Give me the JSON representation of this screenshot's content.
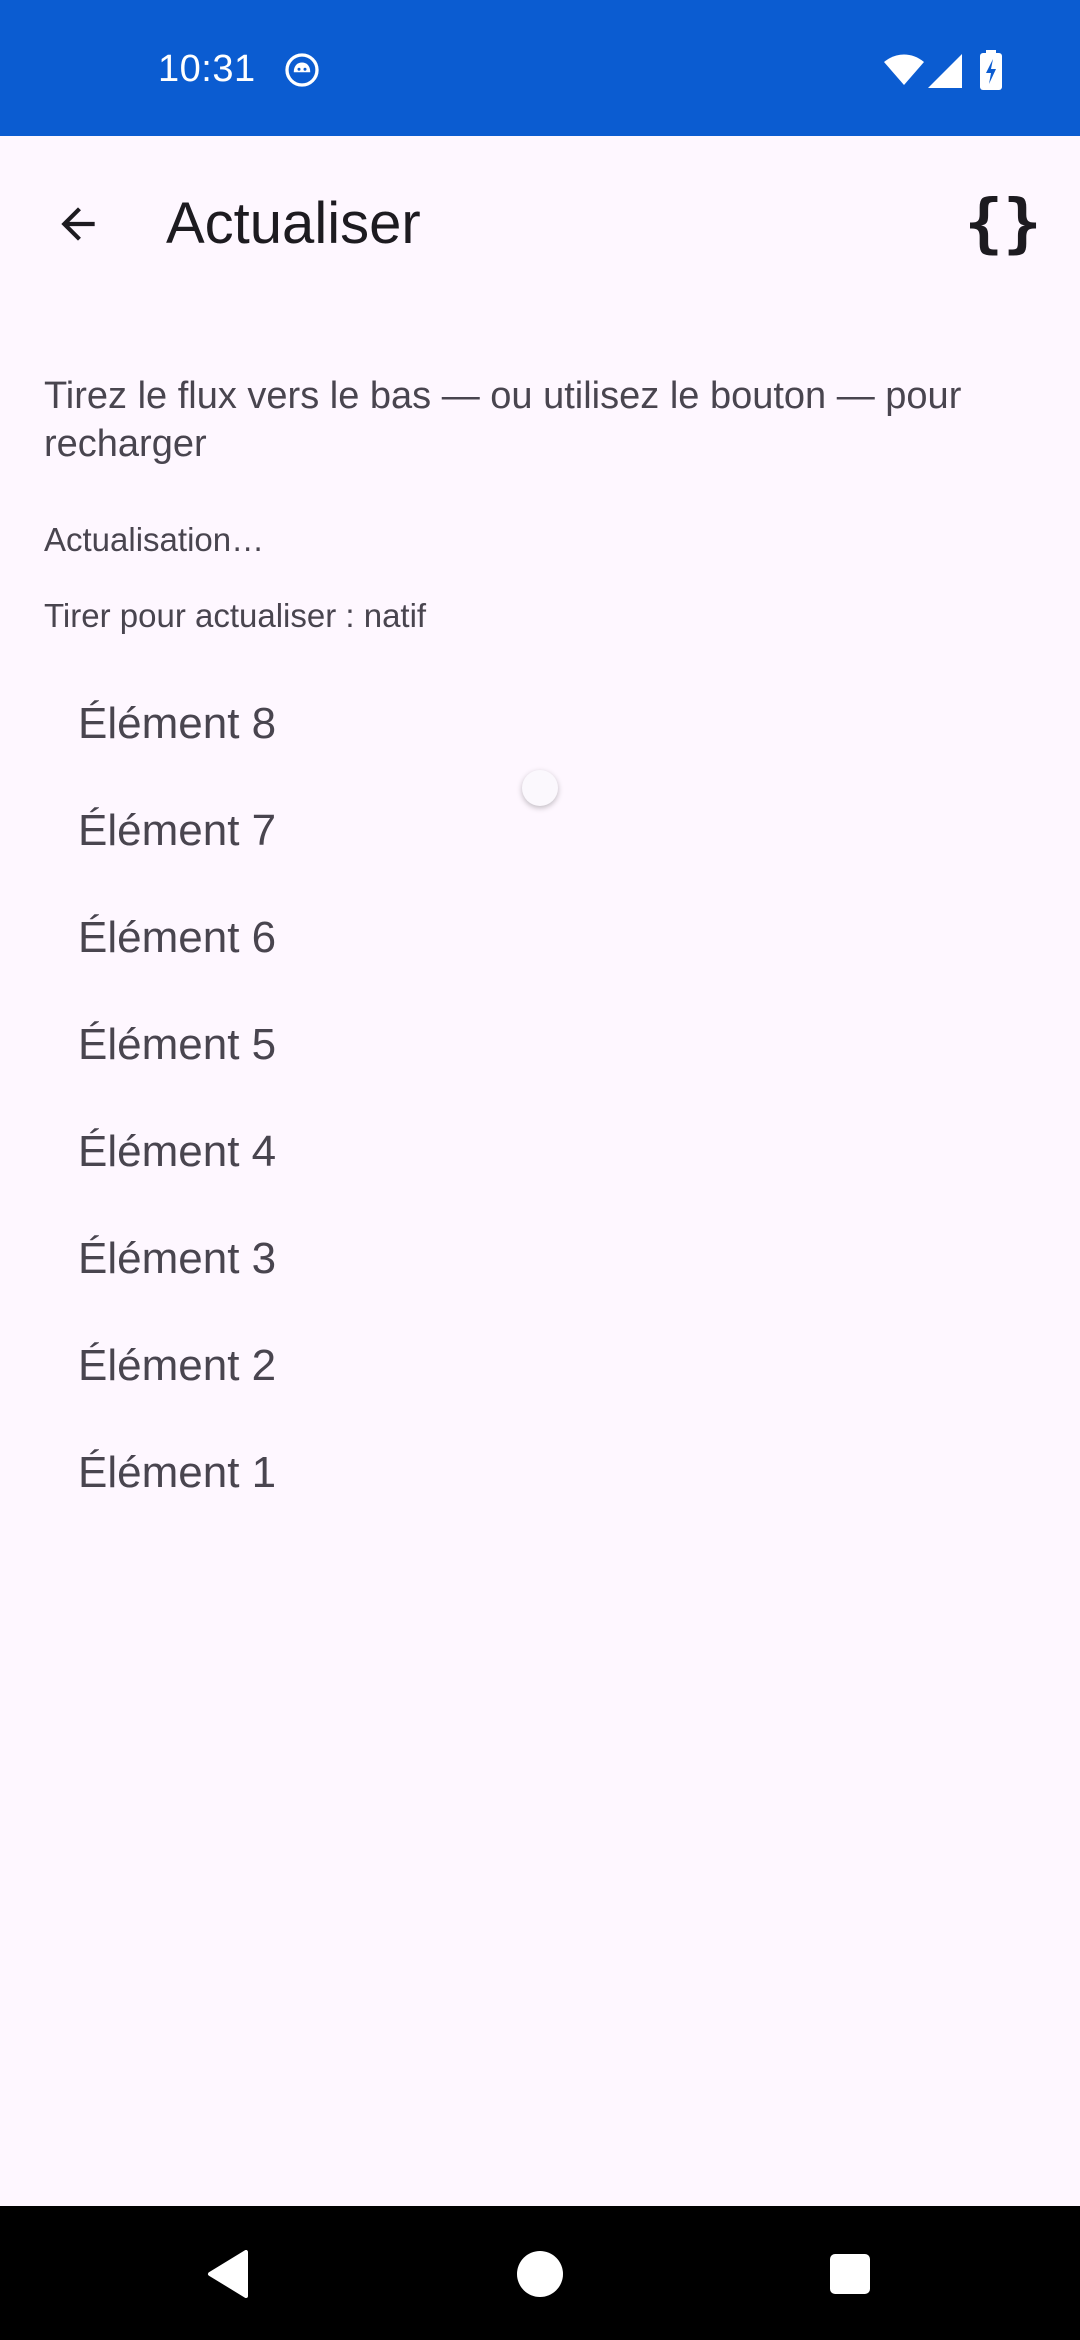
{
  "status_bar": {
    "time": "10:31",
    "icons": [
      "notification-icon",
      "wifi-icon",
      "signal-icon",
      "battery-charging-icon"
    ],
    "background": "#0B5CD1"
  },
  "app_bar": {
    "title": "Actualiser",
    "back_icon": "arrow-back-icon",
    "action_icon": "braces-icon",
    "action_label": "{}"
  },
  "content": {
    "instruction": "Tirez le flux vers le bas — ou utilisez le bouton — pour recharger",
    "status": "Actualisation…",
    "mode": "Tirer pour actualiser : natif",
    "items": [
      "Élément 8",
      "Élément 7",
      "Élément 6",
      "Élément 5",
      "Élément 4",
      "Élément 3",
      "Élément 2",
      "Élément 1"
    ]
  },
  "nav_bar": {
    "icons": [
      "nav-back-icon",
      "nav-home-icon",
      "nav-recents-icon"
    ]
  },
  "colors": {
    "background": "#FEF7FF",
    "text_primary": "#1D1B20",
    "text_secondary": "#49454F",
    "status_bar": "#0B5CD1",
    "nav_bar": "#000000"
  }
}
